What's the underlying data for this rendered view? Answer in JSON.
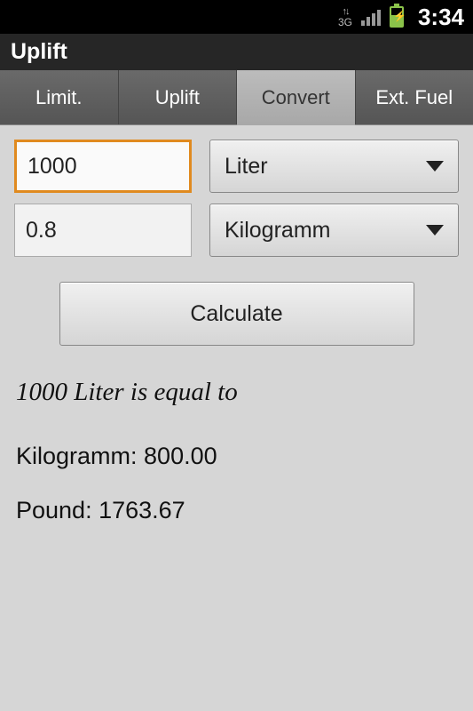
{
  "status": {
    "time": "3:34"
  },
  "title": "Uplift",
  "tabs": {
    "t0": "Limit.",
    "t1": "Uplift",
    "t2": "Convert",
    "t3": "Ext. Fuel",
    "active_index": 2
  },
  "inputs": {
    "amount": "1000",
    "density": "0.8"
  },
  "dropdowns": {
    "unit1": "Liter",
    "unit2": "Kilogramm"
  },
  "buttons": {
    "calculate": "Calculate"
  },
  "result": {
    "equal_line": "1000 Liter is equal to",
    "kg_line": "Kilogramm: 800.00",
    "lb_line": "Pound: 1763.67"
  }
}
